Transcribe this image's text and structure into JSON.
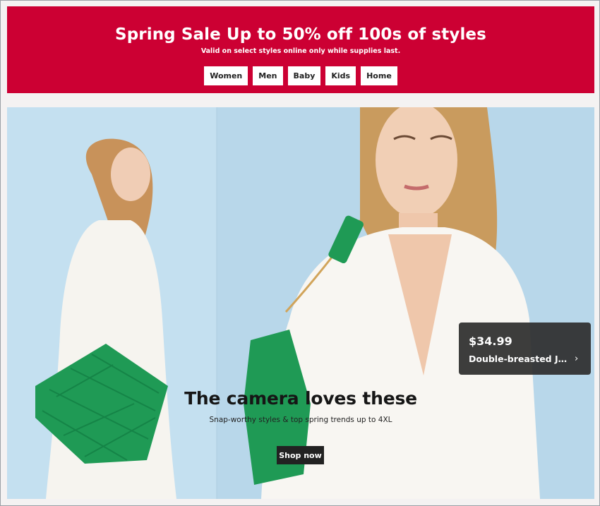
{
  "banner": {
    "title": "Spring Sale Up to 50% off 100s of styles",
    "subtitle": "Valid on select styles online only while supplies last.",
    "categories": [
      "Women",
      "Men",
      "Baby",
      "Kids",
      "Home"
    ],
    "background": "#cc0033"
  },
  "hero": {
    "title": "The camera loves these",
    "subtitle": "Snap-worthy styles & top spring trends up to 4XL",
    "cta": "Shop now",
    "product": {
      "price": "$34.99",
      "name": "Double-breasted Jac…",
      "icon": "chevron-right-icon"
    }
  }
}
